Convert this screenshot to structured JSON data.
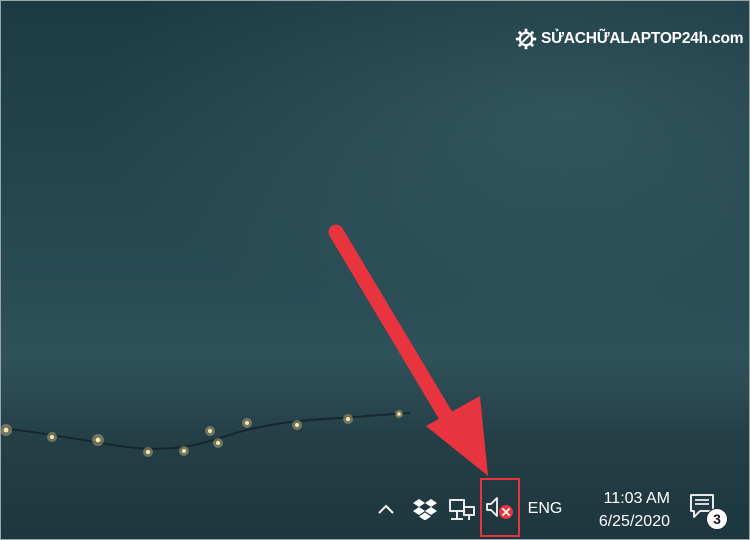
{
  "watermark": {
    "text": "SỬACHỮALAPTOP24h.com",
    "icon": "gear-icon"
  },
  "taskbar": {
    "tray": {
      "show_hidden_icon": "chevron-up-icon",
      "dropbox_icon": "dropbox-icon",
      "network_icon": "network-icon",
      "volume_icon": "speaker-muted-error-icon",
      "language": "ENG"
    },
    "clock": {
      "time": "11:03 AM",
      "date": "6/25/2020"
    },
    "notifications": {
      "icon": "action-center-icon",
      "count": "3"
    }
  },
  "annotation": {
    "arrow_color": "#e8343f",
    "highlight_color": "#e8343f"
  },
  "colors": {
    "error_badge": "#e8343f",
    "taskbar_text": "#ffffff"
  }
}
